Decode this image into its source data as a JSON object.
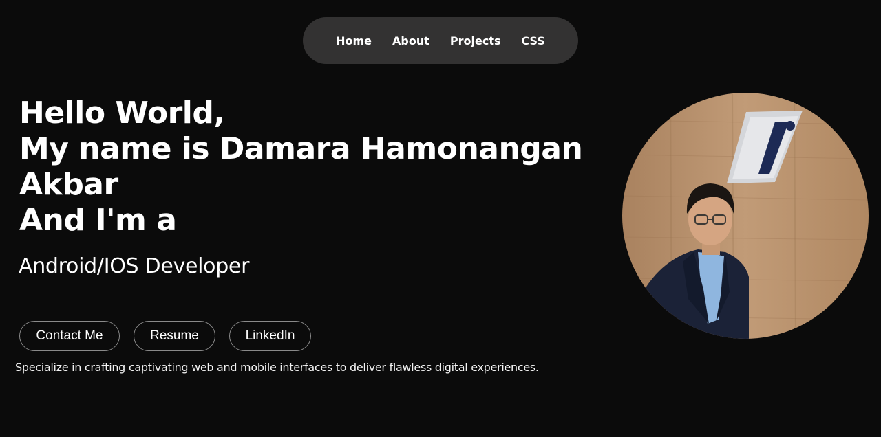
{
  "nav": {
    "items": [
      {
        "label": "Home"
      },
      {
        "label": "About"
      },
      {
        "label": "Projects"
      },
      {
        "label": "CSS"
      }
    ]
  },
  "hero": {
    "lines": [
      "Hello World,",
      "My name is Damara Hamonangan",
      "Akbar",
      "And I'm a"
    ],
    "role": "Android/IOS Developer"
  },
  "buttons": {
    "contact": "Contact Me",
    "resume": "Resume",
    "linkedin": "LinkedIn"
  },
  "tagline": "Specialize in crafting captivating web and mobile interfaces to deliver flawless digital experiences.",
  "profile_photo": {
    "description_icon": "profile-photo"
  },
  "colors": {
    "background": "#0b0b0b",
    "nav_background": "#333232",
    "text": "#ffffff",
    "button_border": "#8a8a8a"
  }
}
